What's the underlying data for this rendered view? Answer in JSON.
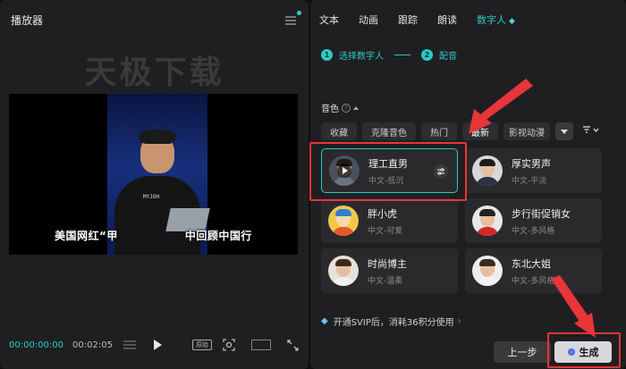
{
  "player": {
    "title": "播放器",
    "watermark": "天极下载",
    "subtitle": "美国网红“甲　　　　　　中回顾中国行",
    "shirt_text": "MYJOH",
    "time_current": "00:00:00:00",
    "time_total": "00:02:05",
    "ratio_label": "原始"
  },
  "tabs": [
    {
      "label": "文本"
    },
    {
      "label": "动画"
    },
    {
      "label": "跟踪"
    },
    {
      "label": "朗读"
    },
    {
      "label": "数字人"
    }
  ],
  "steps": [
    {
      "num": "1",
      "label": "选择数字人"
    },
    {
      "num": "2",
      "label": "配音"
    }
  ],
  "section": {
    "label": "音色",
    "help": "?"
  },
  "chips": [
    {
      "label": "收藏"
    },
    {
      "label": "克隆音色"
    },
    {
      "label": "热门"
    },
    {
      "label": "最新"
    },
    {
      "label": "影视动漫"
    }
  ],
  "voices": [
    {
      "name": "理工直男",
      "tag": "中文-低沉",
      "hair": "#1c1c1c",
      "shirt": "#6a7380",
      "bg": "#48505e"
    },
    {
      "name": "厚实男声",
      "tag": "中文-平淡",
      "hair": "#1c1c1c",
      "shirt": "#2c3342",
      "bg": "#d8d8d8"
    },
    {
      "name": "胖小虎",
      "tag": "中文-可爱",
      "hair": "#2f7fd0",
      "shirt": "#e05a2b",
      "bg": "#f3c64b"
    },
    {
      "name": "步行街促销女",
      "tag": "中文-多风格",
      "hair": "#222222",
      "shirt": "#d62828",
      "bg": "#e7e7e7"
    },
    {
      "name": "时尚博主",
      "tag": "中文-温柔",
      "hair": "#3a2a20",
      "shirt": "#f0f0f0",
      "bg": "#e8e0d8"
    },
    {
      "name": "东北大姐",
      "tag": "中文-多风格",
      "hair": "#3a2a20",
      "shirt": "#f2f2f2",
      "bg": "#eeeeee"
    }
  ],
  "vip": {
    "text": "开通SVIP后，消耗36积分使用"
  },
  "buttons": {
    "prev": "上一步",
    "generate": "生成"
  },
  "colors": {
    "accent": "#2cc9c4",
    "annotation": "#e8353a"
  }
}
